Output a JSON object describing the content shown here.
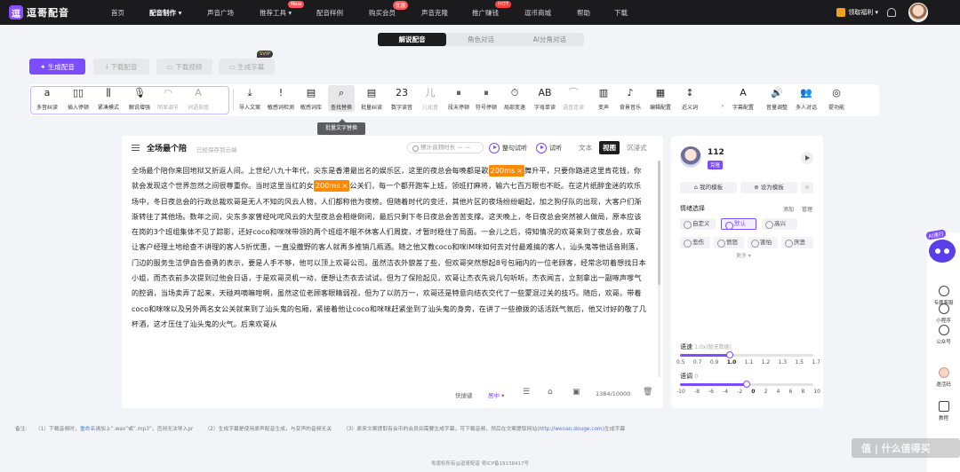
{
  "app": {
    "logo_mark": "逗",
    "logo_text": "逗哥配音"
  },
  "nav": {
    "items": [
      "首页",
      "配音制作 ▾",
      "声音广场",
      "推荐工具 ▾",
      "配音样例",
      "购买会员",
      "声音克隆",
      "推广赚钱",
      "逗币商城",
      "帮助",
      "下载"
    ],
    "badge_new": "New",
    "badge_vip": "优惠",
    "badge_hot": "HOT",
    "gift": "领取福利 ▾",
    "accent": "#7c4dff"
  },
  "mode_tabs": [
    "解说配音",
    "角色对话",
    "AI分角对话"
  ],
  "actions": {
    "generate": "生成配音",
    "download_audio": "下载配音",
    "download_video": "下载视频",
    "subtitle": "生成字幕",
    "svip": "SVIP"
  },
  "tools_group1": [
    {
      "label": "多音纠读",
      "icon": "a"
    },
    {
      "label": "插入停顿",
      "icon": "▯▯"
    },
    {
      "label": "紧凑模式",
      "icon": "⫼"
    },
    {
      "label": "解说增强",
      "icon": "🎙"
    },
    {
      "label": "明显调节",
      "icon": "◠"
    },
    {
      "label": "词语指音",
      "icon": "A"
    }
  ],
  "tools_group2": [
    {
      "label": "导入文案",
      "icon": "⤓"
    },
    {
      "label": "敏感词检测",
      "icon": "!"
    },
    {
      "label": "敏感词库",
      "icon": "▤"
    },
    {
      "label": "查找替换",
      "icon": "⌕"
    },
    {
      "label": "批量纠读",
      "icon": "▤"
    },
    {
      "label": "数字读音",
      "icon": "23"
    },
    {
      "label": "儿化音",
      "icon": "儿"
    },
    {
      "label": "段末停顿",
      "icon": "⏸"
    },
    {
      "label": "符号停顿",
      "icon": "⏸"
    },
    {
      "label": "局部变速",
      "icon": "⏱"
    },
    {
      "label": "字母单读",
      "icon": "AB"
    },
    {
      "label": "语音连读",
      "icon": "⌒"
    },
    {
      "label": "变声",
      "icon": "▥"
    },
    {
      "label": "背景音乐",
      "icon": "♪"
    },
    {
      "label": "编辑配置",
      "icon": "▦"
    },
    {
      "label": "近义词",
      "icon": "↕"
    },
    {
      "label": "›",
      "icon": ""
    },
    {
      "label": "字幕配置",
      "icon": "A"
    },
    {
      "label": "音量调整",
      "icon": "🔊"
    },
    {
      "label": "多人对话",
      "icon": "👥"
    },
    {
      "label": "提功能",
      "icon": "◎"
    }
  ],
  "tooltip": "批量文字替换",
  "editor": {
    "title": "全场最个陪",
    "saved": "已经保存到云端",
    "estimate": "预计音频时长 — —",
    "play_full": "整句试听",
    "play_try": "试听",
    "view_tabs": [
      "文本",
      "视图",
      "沉浸式"
    ],
    "pause_mark": "200ms",
    "pause_x": "×",
    "text_a": "全场最个陪你来回地狱又折返人间。上世纪八九十年代，尖东是香港最出名的娱乐区，这里的夜总会每晚都是歌",
    "text_b": "舞升平，只要你路进这里肯花钱，你就会发现这个世界忽然之间很尊重你。当时这里当红的女",
    "text_c": "公关们，每一个都开跑车上班，领班打麻将，输六七百万眼也不眨。在这片纸醉金迷的欢乐场中，冬日夜总会的行政总裁欢哥是无人不知的风云人物，人们都称他为夜榜。但随着时代的变迁，其他片区的夜场纷纷崛起，加之狗仔队的出现，大客户们渐渐转往了其他场。数年之间，尖东多家曾经叱咤风云的大型夜总会相继倒闭，最后只剩下冬日夜总会苦苦支撑。这天晚上，冬日夜总会突然被人做局，原本应该在岗的3个班组集体不见了踪影，还好coco和咪咪带领的两个班组不眠不休客人们周旋，才暂时稳住了局面。一会儿之后，得知情况的欢哥来到了夜总会，欢哥让客户经理土地给查不讲理的客人5折优惠，一直没撒野的客人就再多推销几瓶酒。随之他又教coco和咪IM咪如何去对付最难搞的客人，汕头鬼等他话音刚落，门边的服务生洁伊自告奋勇的表示，要是人手不够，他可以顶上欢哥公司。虽然洁衣外貌差了些，但欢哥突然想起8号包厢内的一位老顾客，经常念叨着想找日本小姐，而杰衣前多次提到过他会日语，于是欢哥灵机一动，便想让杰衣去试试。但为了保险起见，欢哥让杰衣先说几句听听。杰衣闻言，立刻拿出一副啄声嗲气的腔调，当场卖弄了起来，天碰鸡嘀嘛咁啊，虽然这位老顾客眼睛弱视，但为了以防万一，欢哥还是特意向结衣交代了一些蒙混过关的技巧。随后，欢哥。带着coco和咪咪以及另外两名女公关就来到了汕头鬼的包厢，紧接着他让coco和咪咪赶紧坐到了汕头鬼的身旁，在讲了一些撩拨的话活跃气氛后，他又讨好的敬了几杯酒，这才压住了汕头鬼的火气。后来欢哥从",
    "footer_shortcut": "快捷键",
    "footer_align": "居中 ▾",
    "footer_count": "1384/10000"
  },
  "voice": {
    "name": "112",
    "tag": "克隆",
    "my_template": "我的模板",
    "set_template": "设为模板",
    "emotion_title": "情绪选择",
    "emotion_add": "添加",
    "emotion_manage": "管理",
    "emotions_row1": [
      "自定义",
      "默认",
      "高兴"
    ],
    "emotions_row2": [
      "悲伤",
      "愤怒",
      "害怕",
      "厌恶"
    ],
    "more": "更多 ▾",
    "speed_title": "语速",
    "speed_hint": "1.0x(暂无数据)",
    "speed_ticks": [
      "0.5",
      "0.7",
      "0.9",
      "1.0",
      "1.1",
      "1.2",
      "1.3",
      "1.5",
      "1.7"
    ],
    "speed_value": 1.0,
    "pitch_title": "语调",
    "pitch_hint": "0",
    "pitch_ticks": [
      "-10",
      "-8",
      "-6",
      "-4",
      "-2",
      "0",
      "2",
      "4",
      "6",
      "8",
      "10"
    ],
    "pitch_value": 0
  },
  "rightbar": {
    "ai": "AI速行",
    "items": [
      "专属客服",
      "小程序",
      "公众号",
      "邀活码",
      "教程"
    ]
  },
  "notes": {
    "prefix": "备注:",
    "n1a": "（1）下载音频时，",
    "n1link": "重命名",
    "n1b": "请加上“.wav”或“.mp3”，否则无法导入pr",
    "n2": "（2）生成字幕是使用原声配音生成，与变声的音频无关",
    "n3a": "（3）原来文案提取有会币的会员如需要生成字幕，可下载音频，然后在文案提取网站(",
    "n3link": "http://wenan.douge.com",
    "n3b": ")生成字幕"
  },
  "copyright": "粤版权所有@逗哥配音 粤ICP备19138417号",
  "watermark": "值 | 什么值得买"
}
